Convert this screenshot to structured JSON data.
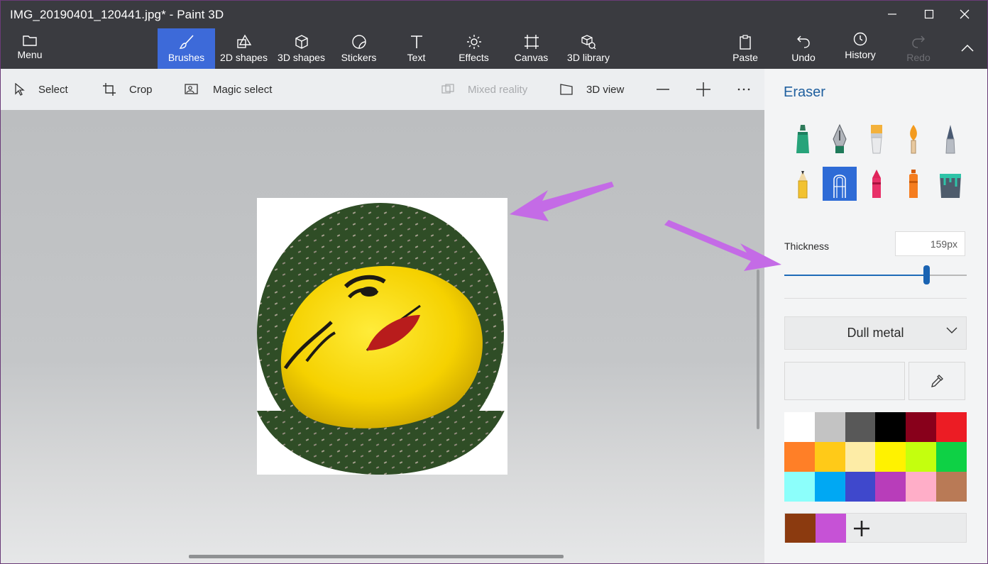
{
  "window": {
    "title": "IMG_20190401_120441.jpg* - Paint 3D"
  },
  "ribbon": {
    "menu_label": "Menu",
    "tools": [
      "Brushes",
      "2D shapes",
      "3D shapes",
      "Stickers",
      "Text",
      "Effects",
      "Canvas",
      "3D library"
    ],
    "active_tool": "Brushes",
    "paste_label": "Paste",
    "undo_label": "Undo",
    "history_label": "History",
    "redo_label": "Redo"
  },
  "toolbar": {
    "select_label": "Select",
    "crop_label": "Crop",
    "magic_select_label": "Magic select",
    "mixed_reality_label": "Mixed reality",
    "view_3d_label": "3D view"
  },
  "panel": {
    "title": "Eraser",
    "brush_icons": [
      "marker-icon",
      "calligraphy-pen-icon",
      "oil-brush-icon",
      "watercolor-icon",
      "pixel-pen-icon",
      "pencil-icon",
      "eraser-icon",
      "crayon-icon",
      "spray-can-icon",
      "fill-bucket-icon"
    ],
    "selected_brush": "eraser-icon",
    "thickness_label": "Thickness",
    "thickness_value": "159px",
    "thickness_fraction": 0.78,
    "material": "Dull metal",
    "palette": [
      "#ffffff",
      "#c3c3c3",
      "#585858",
      "#000000",
      "#88001b",
      "#ec1c24",
      "#ff7f27",
      "#ffca18",
      "#fdeca6",
      "#fff200",
      "#c4ff0e",
      "#0ed145",
      "#8cfffb",
      "#00a8f3",
      "#3f48cc",
      "#b83dba",
      "#ffaec8",
      "#b97a56"
    ],
    "custom_colors": [
      "#8b3a0f",
      "#c652d6"
    ]
  },
  "annotations": {
    "arrow_color": "#c46be6"
  }
}
